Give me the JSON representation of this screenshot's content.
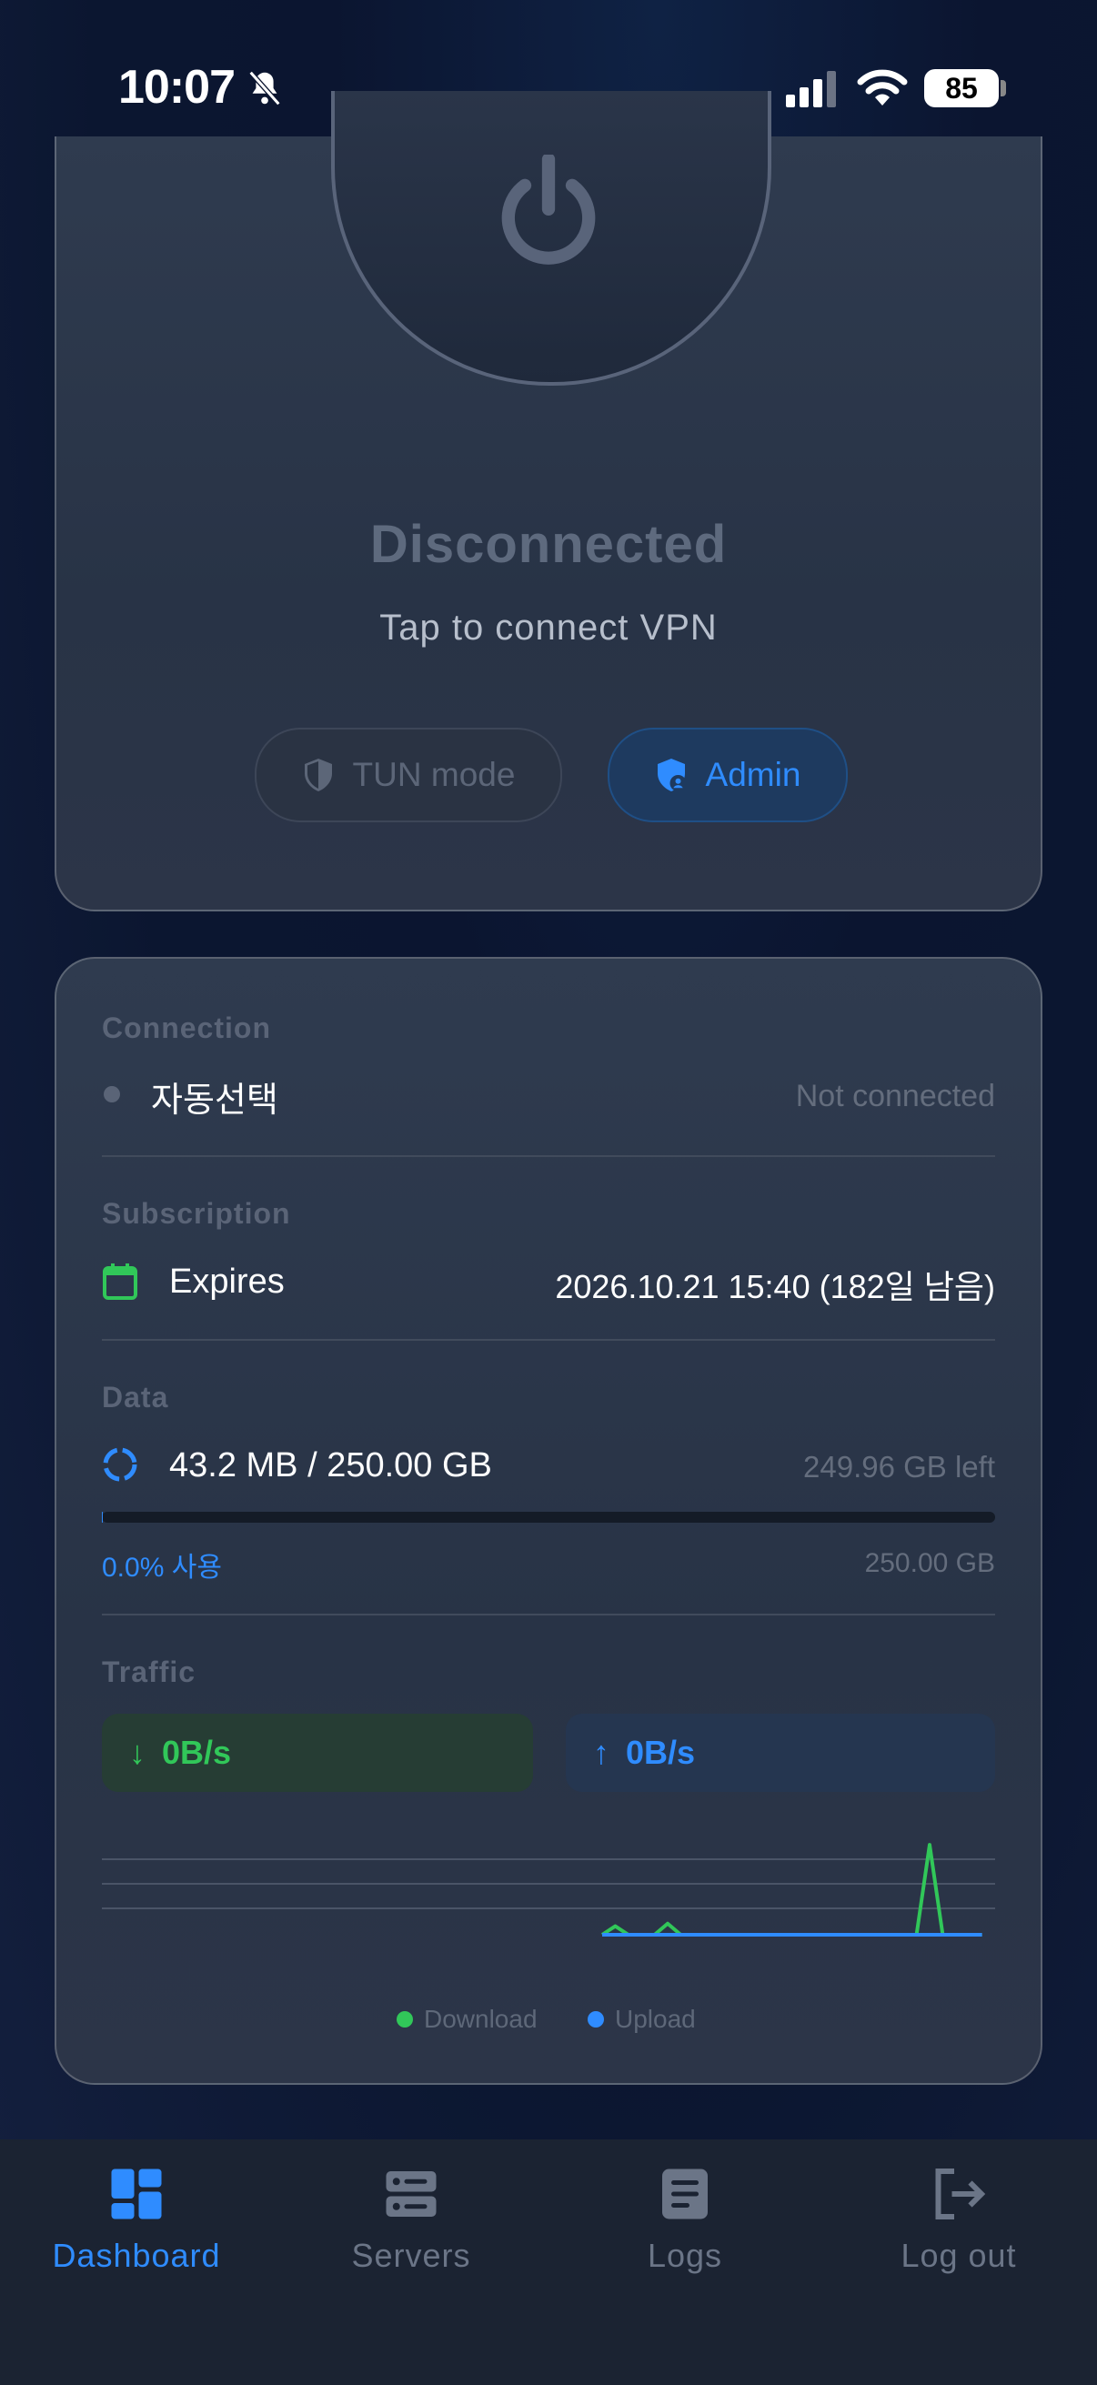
{
  "status_bar": {
    "time": "10:07",
    "battery": "85"
  },
  "vpn": {
    "status": "Disconnected",
    "subtitle": "Tap to connect VPN",
    "tun_mode_label": "TUN mode",
    "admin_label": "Admin"
  },
  "connection": {
    "section": "Connection",
    "server": "자동선택",
    "state": "Not connected"
  },
  "subscription": {
    "section": "Subscription",
    "label": "Expires",
    "value": "2026.10.21 15:40 (182일 남음)"
  },
  "data_usage": {
    "section": "Data",
    "used_total": "43.2 MB / 250.00 GB",
    "left": "249.96 GB left",
    "percent_label": "0.0% 사용",
    "total": "250.00 GB",
    "progress_fraction": 0.0002
  },
  "traffic": {
    "section": "Traffic",
    "download_speed": "0B/s",
    "upload_speed": "0B/s",
    "legend_download": "Download",
    "legend_upload": "Upload"
  },
  "chart_data": {
    "type": "line",
    "series": [
      {
        "name": "Download",
        "color": "#31c759",
        "values": [
          0,
          0,
          0,
          0,
          0,
          0,
          0,
          0,
          0,
          0,
          0,
          0,
          0,
          0,
          0,
          0,
          0,
          0,
          0,
          0,
          0,
          0,
          0,
          0,
          0,
          0,
          0,
          0,
          0,
          0,
          0,
          0,
          0,
          0,
          0,
          0,
          0,
          0,
          0,
          0,
          0,
          0,
          0,
          0,
          0,
          0,
          0,
          0,
          0,
          0,
          0,
          0,
          0,
          0,
          0,
          0,
          0,
          0.1,
          0,
          0,
          0,
          0.13,
          0,
          0,
          0,
          0,
          0,
          0,
          0,
          0,
          0,
          0,
          0,
          0,
          0,
          0,
          0,
          0,
          0,
          0,
          0,
          1.05,
          0,
          0,
          0,
          0,
          0
        ]
      },
      {
        "name": "Upload",
        "color": "#2f8cff",
        "values": [
          0,
          0,
          0,
          0,
          0,
          0,
          0,
          0,
          0,
          0,
          0,
          0,
          0,
          0,
          0,
          0,
          0,
          0,
          0,
          0,
          0,
          0,
          0,
          0,
          0,
          0,
          0,
          0,
          0,
          0,
          0,
          0,
          0,
          0,
          0,
          0,
          0,
          0,
          0,
          0,
          0,
          0,
          0,
          0,
          0,
          0,
          0,
          0,
          0,
          0,
          0,
          0,
          0,
          0,
          0,
          0,
          0,
          0,
          0,
          0,
          0,
          0,
          0,
          0,
          0,
          0,
          0,
          0,
          0,
          0,
          0,
          0,
          0,
          0,
          0,
          0,
          0,
          0,
          0,
          0,
          0,
          0,
          0,
          0,
          0,
          0,
          0
        ]
      }
    ],
    "ylim": [
      0,
      1.2
    ],
    "grid": true
  },
  "tabs": [
    {
      "label": "Dashboard",
      "icon": "dashboard-icon",
      "active": true
    },
    {
      "label": "Servers",
      "icon": "servers-icon",
      "active": false
    },
    {
      "label": "Logs",
      "icon": "logs-icon",
      "active": false
    },
    {
      "label": "Log out",
      "icon": "logout-icon",
      "active": false
    }
  ],
  "colors": {
    "accent": "#2f8cff",
    "success": "#31c759",
    "muted": "#5a6477"
  }
}
